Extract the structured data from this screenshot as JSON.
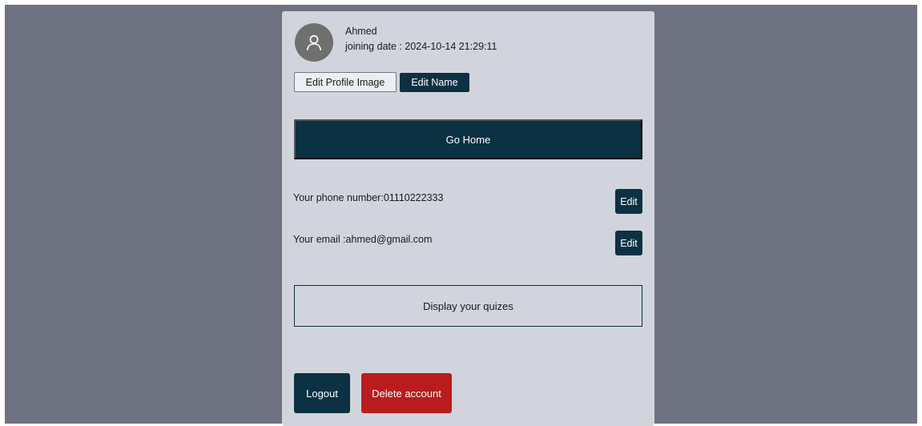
{
  "profile": {
    "name": "Ahmed",
    "joining": "joining date : 2024-10-14 21:29:11",
    "avatar_icon": "user-icon"
  },
  "actions": {
    "edit_profile_image": "Edit Profile Image",
    "edit_name": "Edit Name",
    "go_home": "Go Home"
  },
  "contact": {
    "phone": "Your phone number:01110222333",
    "email": "Your email :ahmed@gmail.com",
    "edit_label": "Edit"
  },
  "quizes": {
    "label": "Display your quizes"
  },
  "account": {
    "logout": "Logout",
    "delete": "Delete account"
  },
  "colors": {
    "page_bg": "#6e7280",
    "card_bg": "#d1d4dc",
    "primary": "#0b3142",
    "danger": "#b91c1c",
    "avatar_bg": "#6f6f6f"
  }
}
